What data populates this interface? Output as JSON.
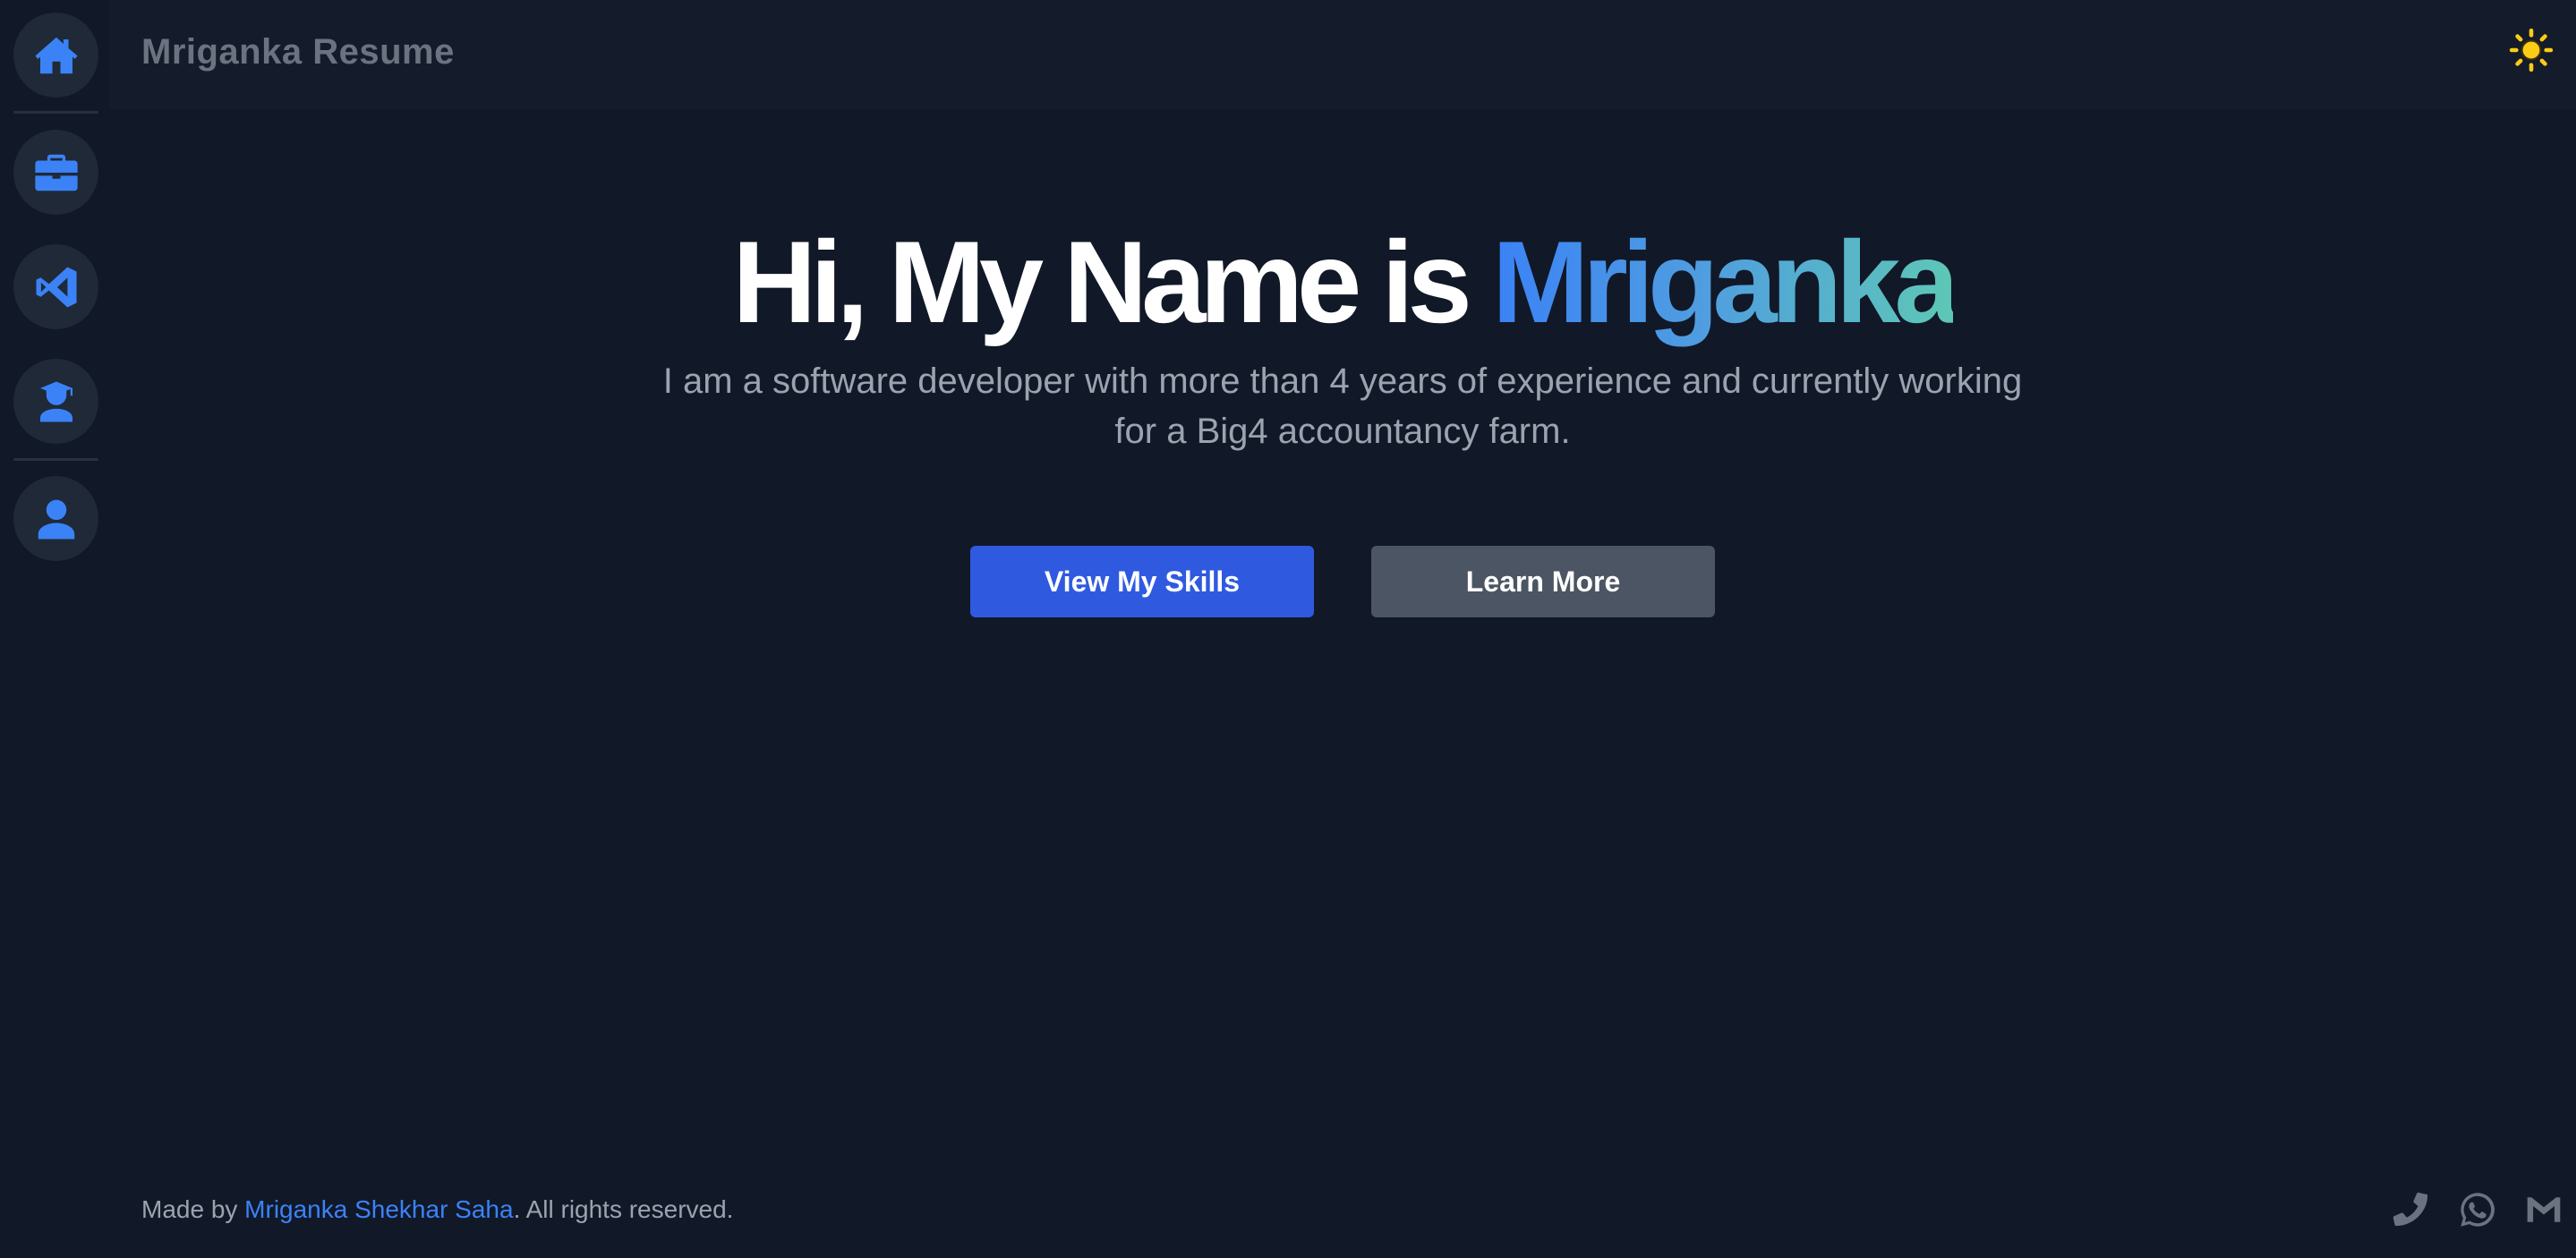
{
  "header": {
    "title": "Mriganka Resume"
  },
  "sidebar": {
    "items": [
      {
        "icon": "home-icon",
        "label": "Home"
      },
      {
        "icon": "briefcase-icon",
        "label": "Experience"
      },
      {
        "icon": "vscode-icon",
        "label": "Skills"
      },
      {
        "icon": "graduate-icon",
        "label": "Education"
      },
      {
        "icon": "user-icon",
        "label": "About"
      }
    ]
  },
  "hero": {
    "title_prefix": "Hi, My Name is ",
    "title_name": "Mriganka",
    "subtitle": "I am a software developer with more than 4 years of experience and currently working for a Big4 accountancy farm.",
    "primary_button": "View My Skills",
    "secondary_button": "Learn More"
  },
  "footer": {
    "made_by": "Made by ",
    "author": "Mriganka Shekhar Saha",
    "rights": ". All rights reserved.",
    "icons": [
      "phone-icon",
      "whatsapp-icon",
      "gmail-icon"
    ]
  },
  "colors": {
    "background": "#111827",
    "accent": "#3b82f6",
    "primary_button": "#2f5ae0",
    "secondary_button": "#4b5563",
    "sun": "#facc15",
    "gradient_end": "#5ec7b6"
  }
}
